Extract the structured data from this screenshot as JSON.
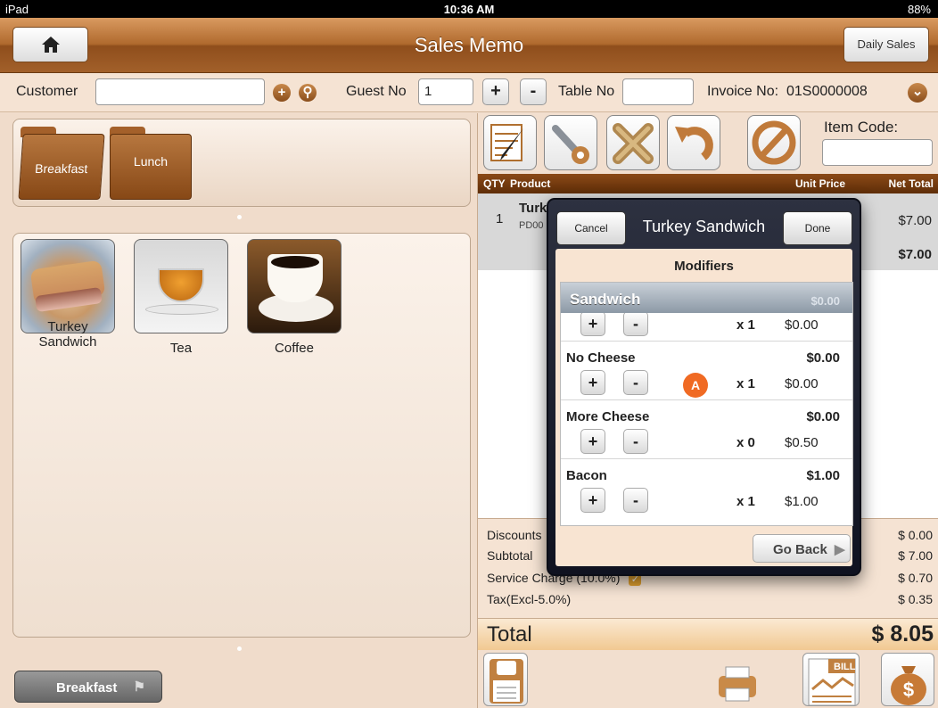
{
  "status_bar": {
    "device": "iPad",
    "time": "10:36 AM",
    "battery": "88%"
  },
  "nav": {
    "title": "Sales Memo",
    "daily_sales": "Daily Sales"
  },
  "header": {
    "customer_label": "Customer",
    "customer_value": "",
    "guest_label": "Guest No",
    "guest_value": "1",
    "table_label": "Table No",
    "table_value": "",
    "invoice_label": "Invoice No:",
    "invoice_value": "01S0000008"
  },
  "categories": [
    "Breakfast",
    "Lunch"
  ],
  "menu_items": [
    {
      "name": "Turkey Sandwich"
    },
    {
      "name": "Tea"
    },
    {
      "name": "Coffee"
    }
  ],
  "category_selector": {
    "label": "Breakfast"
  },
  "toolbar": {
    "item_code_label": "Item Code:"
  },
  "order_table": {
    "headers": {
      "qty": "QTY",
      "product": "Product",
      "unit_price": "Unit Price",
      "net_total": "Net Total"
    },
    "rows": [
      {
        "qty": "1",
        "product": "Turk",
        "code": "PD00",
        "price": "$7.00",
        "total": "$7.00"
      }
    ]
  },
  "summary": {
    "discounts_label": "Discounts",
    "discounts_value": "$ 0.00",
    "subtotal_label": "Subtotal",
    "subtotal_value": "$ 7.00",
    "service_label": "Service Charge (10.0%)",
    "service_value": "$ 0.70",
    "tax_label": "Tax(Excl-5.0%)",
    "tax_value": "$ 0.35",
    "total_label": "Total",
    "total_value": "$ 8.05"
  },
  "popup": {
    "title": "Turkey Sandwich",
    "cancel": "Cancel",
    "done": "Done",
    "modifiers_title": "Modifiers",
    "section": {
      "name": "Sandwich",
      "price": "$0.00"
    },
    "rows": [
      {
        "name": "",
        "price": "",
        "qty": "x 1",
        "unit": "$0.00"
      },
      {
        "name": "No Cheese",
        "price": "$0.00",
        "qty": "x 1",
        "unit": "$0.00"
      },
      {
        "name": "More Cheese",
        "price": "$0.00",
        "qty": "x 0",
        "unit": "$0.50"
      },
      {
        "name": "Bacon",
        "price": "$1.00",
        "qty": "x 1",
        "unit": "$1.00"
      }
    ],
    "badge": "A",
    "go_back": "Go Back"
  },
  "bottom_icons": {
    "bill_label": "BILL"
  }
}
